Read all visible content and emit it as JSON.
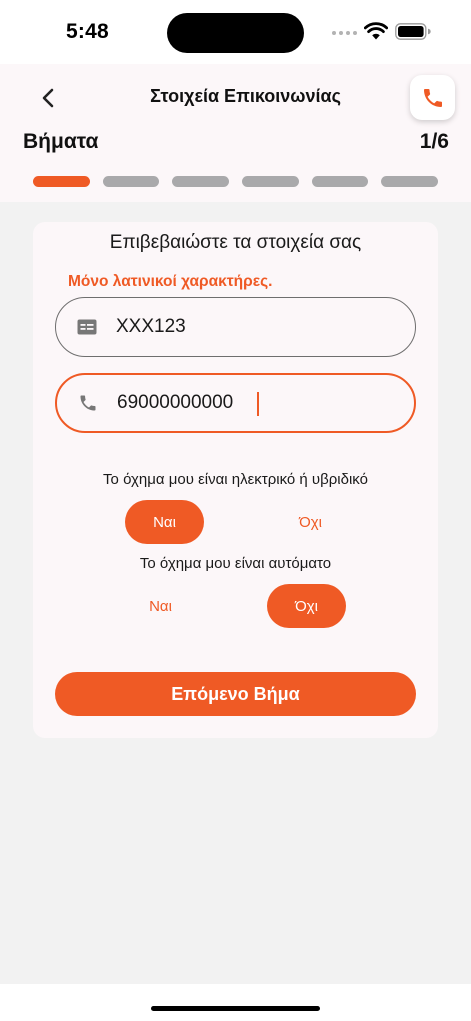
{
  "status_bar": {
    "time": "5:48"
  },
  "header": {
    "title": "Στοιχεία Επικοινωνίας",
    "steps_label": "Βήματα",
    "steps_count": "1/6",
    "current_step": 1,
    "total_steps": 6
  },
  "form": {
    "heading": "Επιβεβαιώστε τα στοιχεία σας",
    "warning": "Μόνο λατινικοί χαρακτήρες.",
    "plate": {
      "value": "XXX123",
      "icon": "id-card-icon"
    },
    "phone": {
      "value": "69000000000",
      "icon": "phone-icon"
    },
    "electric_question": {
      "label": "Το όχημα μου είναι ηλεκτρικό ή υβριδικό",
      "yes": "Ναι",
      "no": "Όχι",
      "selected": "yes"
    },
    "automatic_question": {
      "label": "Το όχημα μου είναι αυτόματο",
      "yes": "Ναι",
      "no": "Όχι",
      "selected": "no"
    },
    "next_label": "Επόμενο Βήμα"
  },
  "colors": {
    "accent": "#ef5a25",
    "header_bg": "#fcf7f9",
    "page_bg": "#f2f2f2",
    "inactive_step": "#a9a9ab"
  }
}
